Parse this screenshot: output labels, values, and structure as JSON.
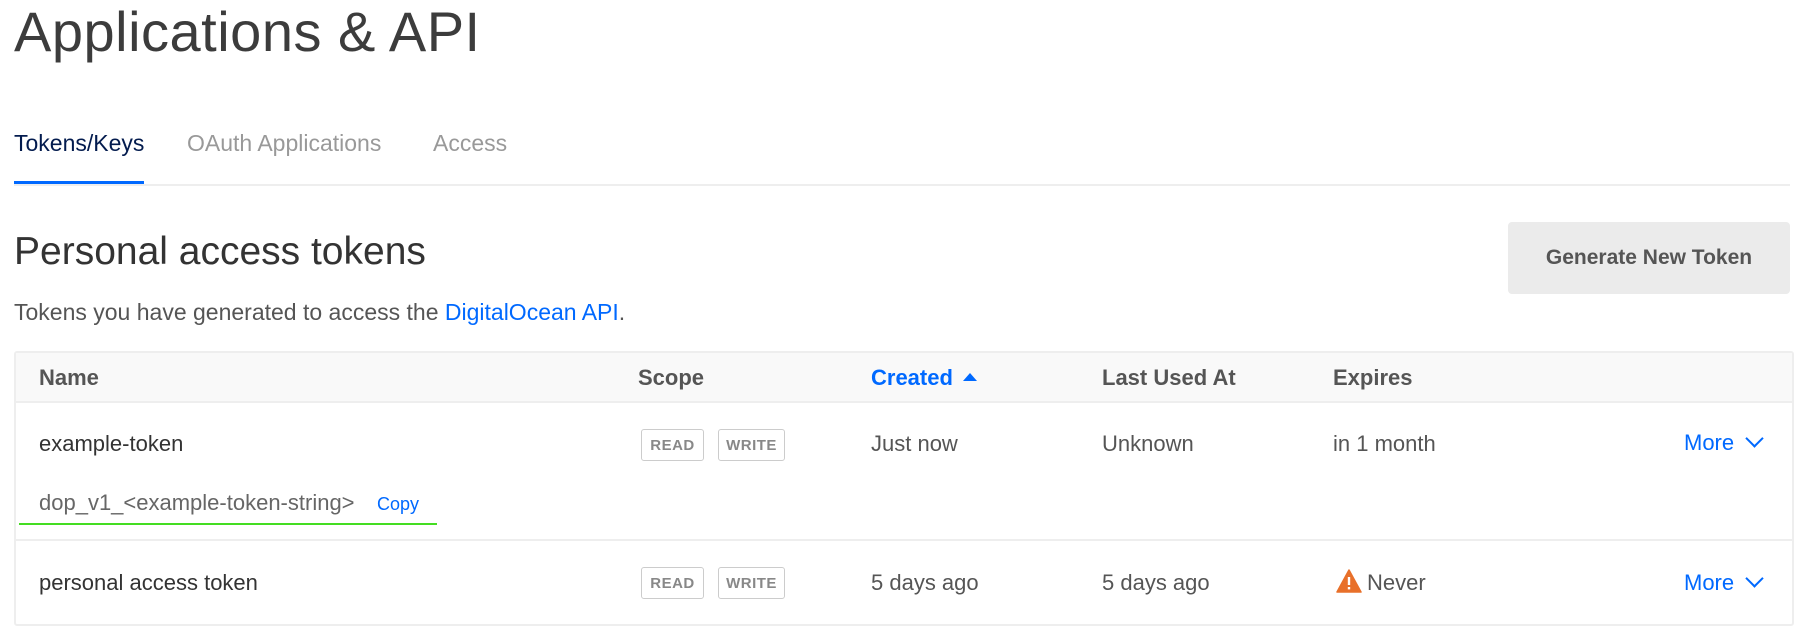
{
  "page": {
    "title": "Applications & API"
  },
  "tabs": [
    {
      "label": "Tokens/Keys",
      "active": true
    },
    {
      "label": "OAuth Applications",
      "active": false
    },
    {
      "label": "Access",
      "active": false
    }
  ],
  "section": {
    "title": "Personal access tokens",
    "description_prefix": "Tokens you have generated to access the ",
    "description_link": "DigitalOcean API",
    "description_suffix": ".",
    "generate_button": "Generate New Token"
  },
  "table": {
    "columns": {
      "name": "Name",
      "scope": "Scope",
      "created": "Created",
      "last_used": "Last Used At",
      "expires": "Expires"
    },
    "sorted_column": "created",
    "sort_direction": "ascending",
    "rows": [
      {
        "name": "example-token",
        "scope_read": "READ",
        "scope_write": "WRITE",
        "created": "Just now",
        "last_used": "Unknown",
        "expires": "in 1 month",
        "more": "More",
        "token_value": "dop_v1_<example-token-string>",
        "copy": "Copy"
      },
      {
        "name": "personal access token",
        "scope_read": "READ",
        "scope_write": "WRITE",
        "created": "5 days ago",
        "last_used": "5 days ago",
        "expires": "Never",
        "expires_icon": "warning-icon",
        "more": "More"
      }
    ]
  },
  "colors": {
    "accent": "#0069ff",
    "warning": "#e8702a",
    "token_underline": "#44dd22",
    "active_tab_text": "#031b4e"
  }
}
